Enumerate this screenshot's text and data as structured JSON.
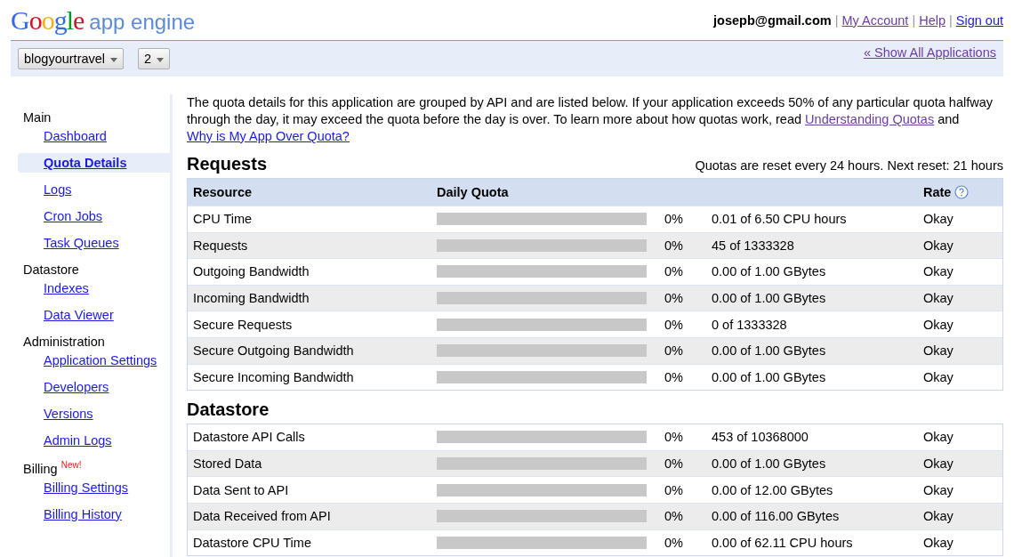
{
  "logo": {
    "brand": "Google",
    "product": "app engine"
  },
  "user": {
    "email": "josepb@gmail.com",
    "separator": "|",
    "links": [
      {
        "label": "My Account",
        "visited": true
      },
      {
        "label": "Help",
        "visited": true
      },
      {
        "label": "Sign out",
        "visited": false
      }
    ]
  },
  "app_bar": {
    "app_select": "blogyourtravel",
    "version_select": "2",
    "show_all": {
      "label": "« Show All Applications",
      "visited": true
    }
  },
  "sidebar": {
    "sections": [
      {
        "title": "Main",
        "items": [
          {
            "label": "Dashboard",
            "selected": false
          },
          {
            "label": "Quota Details",
            "selected": true
          },
          {
            "label": "Logs",
            "selected": false
          },
          {
            "label": "Cron Jobs",
            "selected": false
          },
          {
            "label": "Task Queues",
            "selected": false
          }
        ]
      },
      {
        "title": "Datastore",
        "items": [
          {
            "label": "Indexes",
            "selected": false
          },
          {
            "label": "Data Viewer",
            "selected": false
          }
        ]
      },
      {
        "title": "Administration",
        "items": [
          {
            "label": "Application Settings",
            "selected": false
          },
          {
            "label": "Developers",
            "selected": false
          },
          {
            "label": "Versions",
            "selected": false
          },
          {
            "label": "Admin Logs",
            "selected": false
          }
        ]
      },
      {
        "title": "Billing",
        "badge": "New!",
        "items": [
          {
            "label": "Billing Settings",
            "selected": false
          },
          {
            "label": "Billing History",
            "selected": false
          }
        ]
      }
    ]
  },
  "intro": {
    "text": "The quota details for this application are grouped by API and are listed below. If your application exceeds 50% of any particular quota halfway through the day, it may exceed the quota before the day is over. To learn more about how quotas work, read",
    "link1": {
      "label": "Understanding Quotas",
      "visited": true
    },
    "and": "and",
    "link2": {
      "label": "Why is My App Over Quota?",
      "visited": false
    }
  },
  "reset_note": "Quotas are reset every 24 hours. Next reset: 21 hours",
  "columns": [
    "Resource",
    "Daily Quota",
    "Rate"
  ],
  "sections": [
    {
      "title": "Requests",
      "rows": [
        {
          "resource": "CPU Time",
          "percent": "0%",
          "usage": "0.01 of 6.50 CPU hours",
          "rate": "Okay"
        },
        {
          "resource": "Requests",
          "percent": "0%",
          "usage": "45 of 1333328",
          "rate": "Okay"
        },
        {
          "resource": "Outgoing Bandwidth",
          "percent": "0%",
          "usage": "0.00 of 1.00 GBytes",
          "rate": "Okay"
        },
        {
          "resource": "Incoming Bandwidth",
          "percent": "0%",
          "usage": "0.00 of 1.00 GBytes",
          "rate": "Okay"
        },
        {
          "resource": "Secure Requests",
          "percent": "0%",
          "usage": "0 of 1333328",
          "rate": "Okay"
        },
        {
          "resource": "Secure Outgoing Bandwidth",
          "percent": "0%",
          "usage": "0.00 of 1.00 GBytes",
          "rate": "Okay"
        },
        {
          "resource": "Secure Incoming Bandwidth",
          "percent": "0%",
          "usage": "0.00 of 1.00 GBytes",
          "rate": "Okay"
        }
      ]
    },
    {
      "title": "Datastore",
      "rows": [
        {
          "resource": "Datastore API Calls",
          "percent": "0%",
          "usage": "453 of 10368000",
          "rate": "Okay"
        },
        {
          "resource": "Stored Data",
          "percent": "0%",
          "usage": "0.00 of 1.00 GBytes",
          "rate": "Okay"
        },
        {
          "resource": "Data Sent to API",
          "percent": "0%",
          "usage": "0.00 of 12.00 GBytes",
          "rate": "Okay"
        },
        {
          "resource": "Data Received from API",
          "percent": "0%",
          "usage": "0.00 of 116.00 GBytes",
          "rate": "Okay"
        },
        {
          "resource": "Datastore CPU Time",
          "percent": "0%",
          "usage": "0.00 of 62.11 CPU hours",
          "rate": "Okay"
        }
      ]
    }
  ]
}
